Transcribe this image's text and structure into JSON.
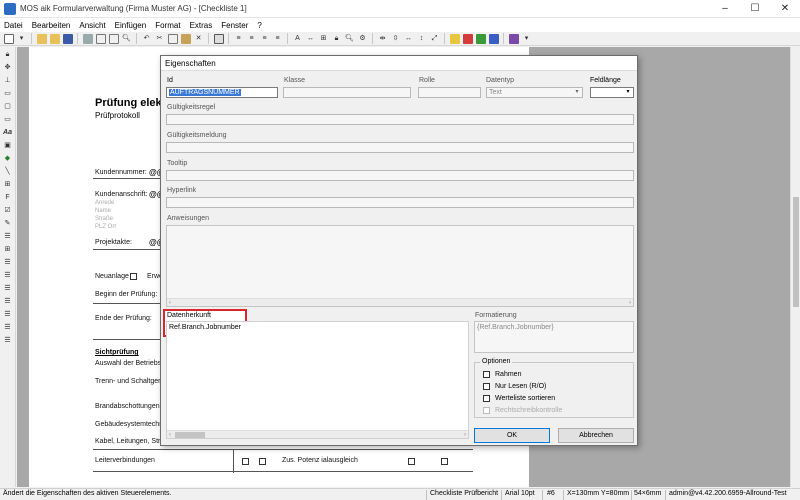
{
  "window": {
    "title": "MOS aik Formularverwaltung (Firma Muster AG) - [Checkliste 1]",
    "controls": [
      "–",
      "☐",
      "✕"
    ]
  },
  "menu": [
    "Datei",
    "Bearbeiten",
    "Ansicht",
    "Einfügen",
    "Format",
    "Extras",
    "Fenster",
    "?"
  ],
  "document": {
    "title": "Prüfung elektrisc",
    "subtitle": "Prüfprotokoll",
    "kundennummer_label": "Kundennummer:",
    "kundennummer_value": "@@@",
    "kundenanschrift_label": "Kundenanschrift:",
    "kundenanschrift_value": "@@@",
    "address_hints": [
      "Anrede",
      "Name",
      "Straße",
      "PLZ Ort"
    ],
    "projektakte_label": "Projektakte:",
    "projektakte_value": "@@@",
    "neuanlage_label": "Neuanlage",
    "erweiterung_label": "Erweiter",
    "beginn_label": "Beginn der Prüfung:",
    "beginn_value": "@@",
    "ende_label": "Ende der Prüfung:",
    "ende_value": "@@",
    "sichtpruefung_heading": "Sichtprüfung",
    "sicht_items": [
      "Auswahl der Betriebsmitt",
      "Trenn- und Schaltgeräte",
      "Brandabschottungen",
      "Gebäudesystemtechnik",
      "Kabel, Leitungen, Stromsc",
      "Leiterverbindungen"
    ],
    "zus_potenz": "Zus. Potenz ialausgleich"
  },
  "dialog": {
    "title": "Eigenschaften",
    "labels": {
      "id": "Id",
      "klasse": "Klasse",
      "rolle": "Rolle",
      "datentyp": "Datentyp",
      "feldlaenge": "Feldlänge",
      "gueltigkeitsregel": "Gültigkeitsregel",
      "gueltigkeitsmeldung": "Gültigkeitsmeldung",
      "tooltip": "Tooltip",
      "hyperlink": "Hyperlink",
      "anweisungen": "Anweisungen",
      "datenherkunft": "Datenherkunft",
      "formatierung": "Formatierung"
    },
    "values": {
      "id": "AUFTRAGSNUMMER",
      "klasse": "",
      "rolle": "",
      "datentyp": "Text",
      "feldlaenge": "",
      "datenherkunft": "Ref.Branch.Jobnumber",
      "formatierung": "{Ref.Branch.Jobnumber}"
    },
    "options": {
      "heading": "Optionen",
      "items": [
        {
          "label": "Rahmen",
          "checked": false,
          "disabled": false
        },
        {
          "label": "Nur Lesen (R/O)",
          "checked": false,
          "disabled": false
        },
        {
          "label": "Werteliste sortieren",
          "checked": false,
          "disabled": false
        },
        {
          "label": "Rechtschreibkontrolle",
          "checked": false,
          "disabled": true
        }
      ]
    },
    "ok_label": "OK",
    "cancel_label": "Abbrechen"
  },
  "statusbar": {
    "message": "Ändert die Eigenschaften des aktiven Steuerelements.",
    "document_name": "Checkliste Prüfbericht",
    "font": "Arial 10pt",
    "index": "#6",
    "position": "X=130mm Y=80mm",
    "size": "54×6mm",
    "user_version": "admin@v4.42.200.6959-Allround-Test"
  },
  "colors": {
    "highlight": "#d9262c",
    "selection": "#3a78d6",
    "default_button_border": "#0078d7"
  }
}
